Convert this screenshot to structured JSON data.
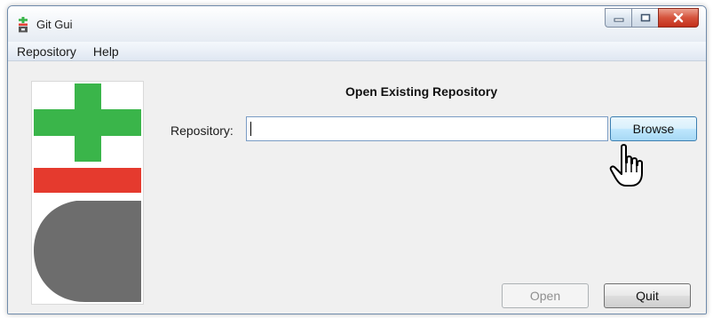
{
  "window": {
    "title": "Git Gui",
    "icon": "git-gui-app-icon"
  },
  "menubar": {
    "items": [
      {
        "label": "Repository"
      },
      {
        "label": "Help"
      }
    ]
  },
  "dialog": {
    "heading": "Open Existing Repository",
    "repository_label": "Repository:",
    "repository_value": "",
    "browse_label": "Browse",
    "open_label": "Open",
    "quit_label": "Quit",
    "open_enabled": false
  },
  "logo": {
    "plus_color": "#3ab54a",
    "minus_color": "#e53a2e",
    "g_color": "#6d6d6d"
  },
  "colors": {
    "close_button": "#c4301b",
    "menubar": "#dfe7f2",
    "input_border": "#7a9cc4"
  },
  "cursor": "hand-pointer-icon"
}
